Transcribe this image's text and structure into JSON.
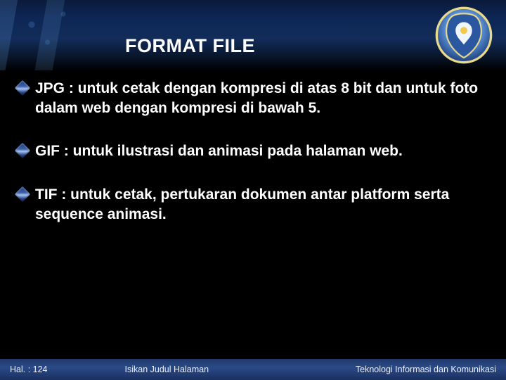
{
  "title": "FORMAT FILE",
  "bullets": [
    {
      "text": "JPG : untuk cetak dengan kompresi di atas 8 bit dan untuk foto dalam web dengan kompresi di bawah 5."
    },
    {
      "text": "GIF : untuk ilustrasi dan animasi pada halaman web."
    },
    {
      "text": "TIF : untuk cetak, pertukaran dokumen antar platform serta sequence animasi."
    }
  ],
  "footer": {
    "page": "Hal. : 124",
    "center": "Isikan Judul Halaman",
    "right": "Teknologi Informasi dan Komunikasi"
  }
}
